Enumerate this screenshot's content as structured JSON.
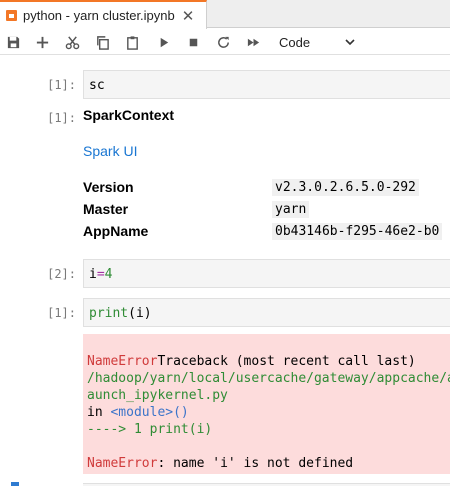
{
  "tab": {
    "label": "python - yarn cluster.ipynb",
    "close_glyph": "✕"
  },
  "toolbar": {
    "cell_type": "Code",
    "icons": [
      "save-icon",
      "add-icon",
      "cut-icon",
      "copy-icon",
      "paste-icon",
      "run-icon",
      "stop-icon",
      "restart-icon",
      "fast-forward-icon",
      "chevron-down-icon"
    ]
  },
  "cells": {
    "c1": {
      "prompt": "[1]:",
      "code": "sc"
    },
    "o1": {
      "prompt": "[1]:",
      "title": "SparkContext",
      "link": "Spark UI",
      "rows": [
        {
          "key": "Version",
          "value": "v2.3.0.2.6.5.0-292"
        },
        {
          "key": "Master",
          "value": "yarn"
        },
        {
          "key": "AppName",
          "value": "0b43146b-f295-46e2-b0"
        }
      ]
    },
    "c2": {
      "prompt": "[2]:",
      "code_var": "i",
      "code_op": "=",
      "code_num": "4"
    },
    "c3": {
      "prompt": "[1]:",
      "code_func": "print",
      "code_rest": "(i)"
    },
    "error": {
      "name1": "NameError",
      "traceback": "Traceback (most recent call last)",
      "path": "/hadoop/yarn/local/usercache/gateway/appcache/a",
      "path2": "aunch_ipykernel.py",
      "in_word": "in ",
      "module": "<module>",
      "parens": "()",
      "arrow": "----> 1 ",
      "arrow_code": "print(i)",
      "name2": "NameError",
      "message": ": name 'i' is not defined"
    }
  },
  "colors": {
    "accent": "#f37726",
    "link": "#1976d2",
    "error_bg": "#fddcdc",
    "error_red": "#d03b3b",
    "keyword_green": "#2f8c35"
  }
}
